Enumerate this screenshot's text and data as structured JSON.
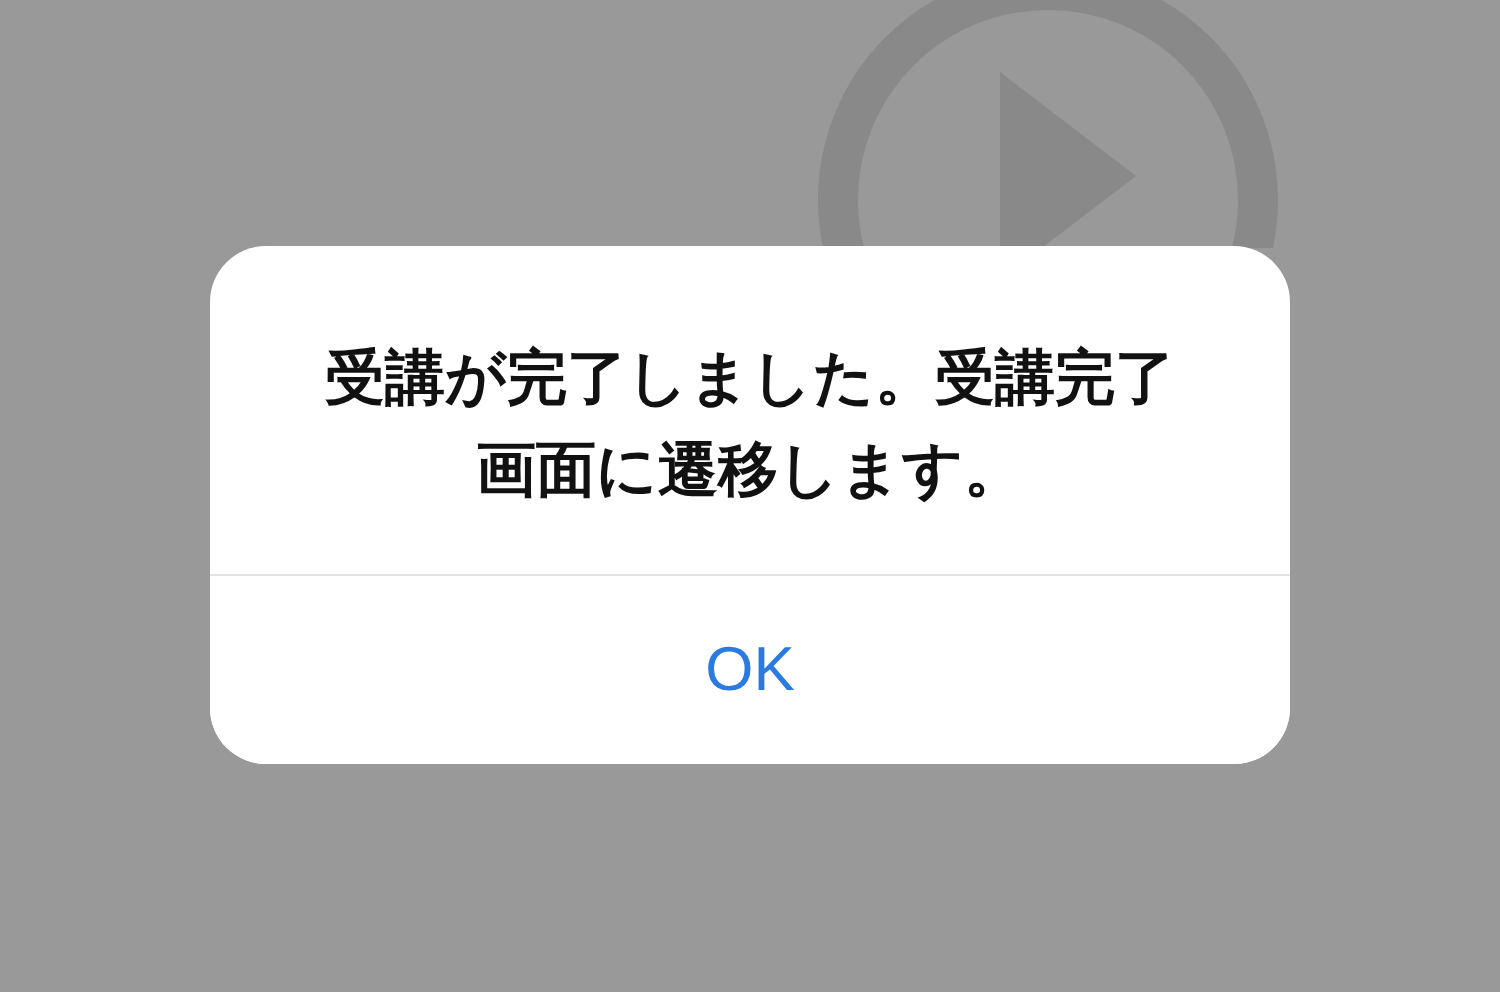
{
  "background": {
    "kind": "video"
  },
  "alert": {
    "message": "受講が完了しました。受講完了画面に遷移します。",
    "buttons": [
      "OK"
    ]
  }
}
